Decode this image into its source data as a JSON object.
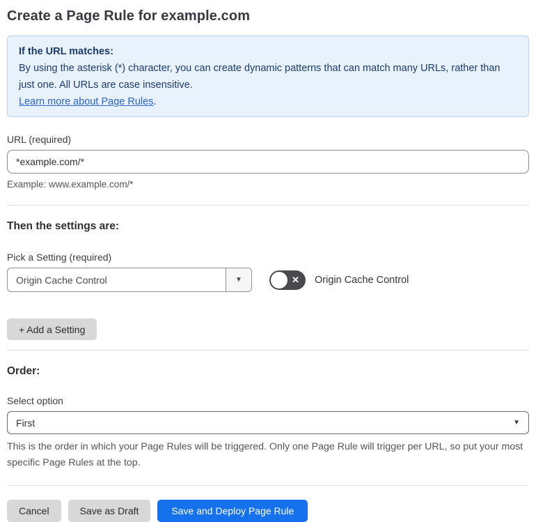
{
  "page": {
    "title": "Create a Page Rule for example.com"
  },
  "info": {
    "heading": "If the URL matches:",
    "body": "By using the asterisk (*) character, you can create dynamic patterns that can match many URLs, rather than just one. All URLs are case insensitive.",
    "link_label": "Learn more about Page Rules",
    "link_suffix": "."
  },
  "url_field": {
    "label": "URL (required)",
    "value": "*example.com/*",
    "example": "Example: www.example.com/*"
  },
  "settings": {
    "heading": "Then the settings are:",
    "pick_label": "Pick a Setting (required)",
    "selected": "Origin Cache Control",
    "toggle_label": "Origin Cache Control",
    "toggle_state": "off",
    "add_button_label": "+ Add a Setting"
  },
  "order": {
    "heading": "Order:",
    "select_label": "Select option",
    "selected": "First",
    "help": "This is the order in which your Page Rules will be triggered. Only one Page Rule will trigger per URL, so put your most specific Page Rules at the top."
  },
  "actions": {
    "cancel_label": "Cancel",
    "save_draft_label": "Save as Draft",
    "save_deploy_label": "Save and Deploy Page Rule"
  },
  "icons": {
    "dropdown_caret": "▼",
    "toggle_x": "✕"
  },
  "colors": {
    "primary_blue": "#1672ec",
    "info_bg": "#e8f2fc",
    "info_border": "#b3d3f0",
    "info_text": "#1c3a6b",
    "link_blue": "#2b63c8",
    "toggle_off_bg": "#4a4a4e",
    "button_gray": "#d8d8d9"
  }
}
